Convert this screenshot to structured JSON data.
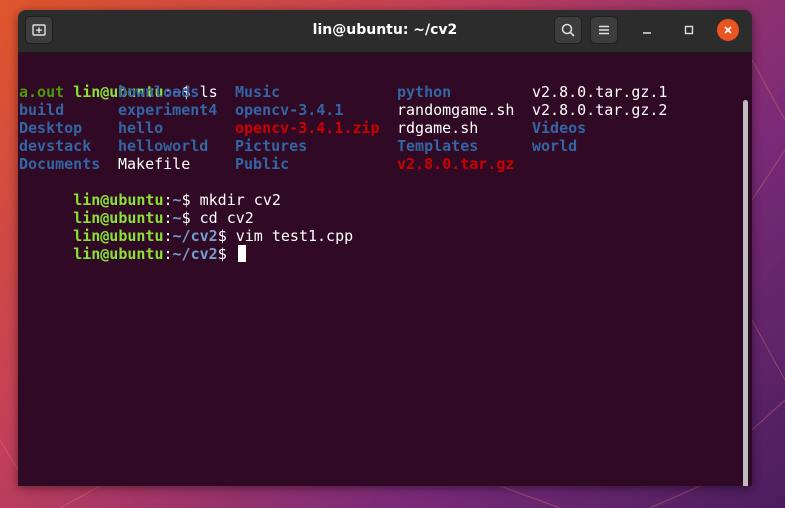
{
  "window": {
    "title": "lin@ubuntu: ~/cv2"
  },
  "icons": {
    "new_tab": "new-tab-icon",
    "search": "search-icon",
    "menu": "hamburger-menu-icon",
    "minimize": "minimize-icon",
    "maximize": "maximize-icon",
    "close": "close-icon"
  },
  "colors": {
    "terminal_bg": "#300a24",
    "user_host": "#8ae234",
    "path": "#729fcf",
    "prompt_sep": "#ffffff",
    "directory": "#3465a4",
    "executable": "#4e9a06",
    "archive": "#cc0000",
    "regular": "#ffffff",
    "close_button": "#e95420"
  },
  "terminal": {
    "prompts": [
      {
        "user": "lin@ubuntu",
        "colon": ":",
        "path": "~",
        "symbol": "$ ",
        "command": "ls"
      },
      {
        "user": "lin@ubuntu",
        "colon": ":",
        "path": "~",
        "symbol": "$ ",
        "command": "mkdir cv2"
      },
      {
        "user": "lin@ubuntu",
        "colon": ":",
        "path": "~",
        "symbol": "$ ",
        "command": "cd cv2"
      },
      {
        "user": "lin@ubuntu",
        "colon": ":",
        "path": "~/cv2",
        "symbol": "$ ",
        "command": "vim test1.cpp"
      },
      {
        "user": "lin@ubuntu",
        "colon": ":",
        "path": "~/cv2",
        "symbol": "$ ",
        "command": ""
      }
    ],
    "ls_rows": [
      [
        {
          "name": "a.out",
          "type": "executable"
        },
        {
          "name": "Downloads",
          "type": "directory"
        },
        {
          "name": "Music",
          "type": "directory"
        },
        {
          "name": "python",
          "type": "directory"
        },
        {
          "name": "v2.8.0.tar.gz.1",
          "type": "regular"
        }
      ],
      [
        {
          "name": "build",
          "type": "directory"
        },
        {
          "name": "experiment4",
          "type": "directory"
        },
        {
          "name": "opencv-3.4.1",
          "type": "directory"
        },
        {
          "name": "randomgame.sh",
          "type": "regular"
        },
        {
          "name": "v2.8.0.tar.gz.2",
          "type": "regular"
        }
      ],
      [
        {
          "name": "Desktop",
          "type": "directory"
        },
        {
          "name": "hello",
          "type": "directory"
        },
        {
          "name": "opencv-3.4.1.zip",
          "type": "archive"
        },
        {
          "name": "rdgame.sh",
          "type": "regular"
        },
        {
          "name": "Videos",
          "type": "directory"
        }
      ],
      [
        {
          "name": "devstack",
          "type": "directory"
        },
        {
          "name": "helloworld",
          "type": "directory"
        },
        {
          "name": "Pictures",
          "type": "directory"
        },
        {
          "name": "Templates",
          "type": "directory"
        },
        {
          "name": "world",
          "type": "directory"
        }
      ],
      [
        {
          "name": "Documents",
          "type": "directory"
        },
        {
          "name": "Makefile",
          "type": "regular"
        },
        {
          "name": "Public",
          "type": "directory"
        },
        {
          "name": "v2.8.0.tar.gz",
          "type": "archive"
        }
      ]
    ]
  }
}
